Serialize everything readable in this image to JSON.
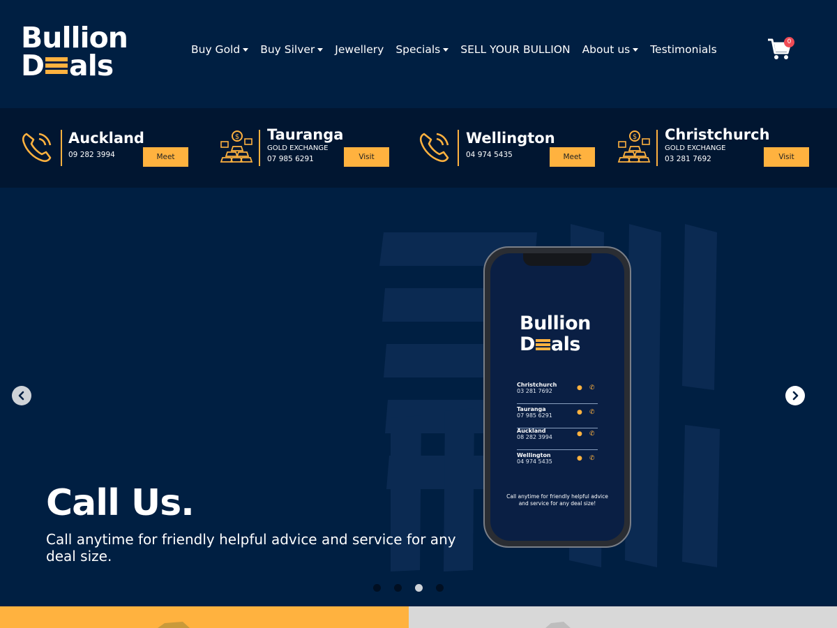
{
  "brand": {
    "line1": "Bullion",
    "line2_a": "D",
    "line2_b": "als",
    "accent": "#ffb23f",
    "background": "#001f42"
  },
  "nav": {
    "items": [
      {
        "label": "Buy Gold",
        "dropdown": true
      },
      {
        "label": "Buy Silver",
        "dropdown": true
      },
      {
        "label": "Jewellery",
        "dropdown": false
      },
      {
        "label": "Specials",
        "dropdown": true
      },
      {
        "label": "SELL YOUR BULLION",
        "dropdown": false
      },
      {
        "label": "About us",
        "dropdown": true
      },
      {
        "label": "Testimonials",
        "dropdown": false
      }
    ],
    "cart_icon": "shopping-cart-icon",
    "cart_count": "0"
  },
  "locations": [
    {
      "city": "Auckland",
      "tagline": "",
      "phone": "09 282 3994",
      "button": "Meet",
      "icon": "phone-call-icon"
    },
    {
      "city": "Tauranga",
      "tagline": "GOLD EXCHANGE",
      "phone": "07 985 6291",
      "button": "Visit",
      "icon": "gold-bars-icon"
    },
    {
      "city": "Wellington",
      "tagline": "",
      "phone": "04 974 5435",
      "button": "Meet",
      "icon": "phone-call-icon"
    },
    {
      "city": "Christchurch",
      "tagline": "GOLD EXCHANGE",
      "phone": "03 281 7692",
      "button": "Visit",
      "icon": "gold-bars-icon"
    }
  ],
  "hero": {
    "title": "Call Us.",
    "subtitle": "Call anytime for friendly helpful advice and service for any deal size.",
    "slide_count": 4,
    "active_slide": 3,
    "phone_screen": {
      "contacts": [
        {
          "city": "Christchurch",
          "phone": "03 281 7692"
        },
        {
          "city": "Tauranga",
          "phone": "07 985 6291"
        },
        {
          "city": "Auckland",
          "phone": "08 282 3994"
        },
        {
          "city": "Wellington",
          "phone": "04 974 5435"
        }
      ],
      "note": "Call anytime for friendly helpful advice and service for any deal size!"
    }
  }
}
